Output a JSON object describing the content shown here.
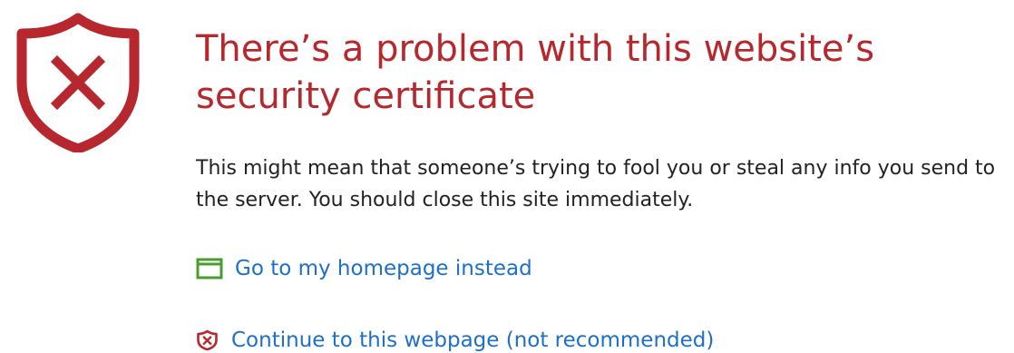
{
  "page": {
    "title": "There’s a problem with this website’s security certificate",
    "description": "This might mean that someone’s trying to fool you or steal any info you send to the server. You should close this site immediately.",
    "actions": [
      {
        "label": "Go to my homepage instead",
        "icon": "homepage-window-icon",
        "icon_color": "#4b9b2f"
      },
      {
        "label": "Continue to this webpage (not recommended)",
        "icon": "shield-x-icon",
        "icon_color": "#b7282e"
      }
    ]
  },
  "icons": {
    "main": "shield-x-icon"
  },
  "colors": {
    "warning": "#b7282e",
    "link": "#1e6fc5",
    "body_text": "#222222",
    "homepage_icon": "#4b9b2f",
    "background": "#ffffff"
  }
}
